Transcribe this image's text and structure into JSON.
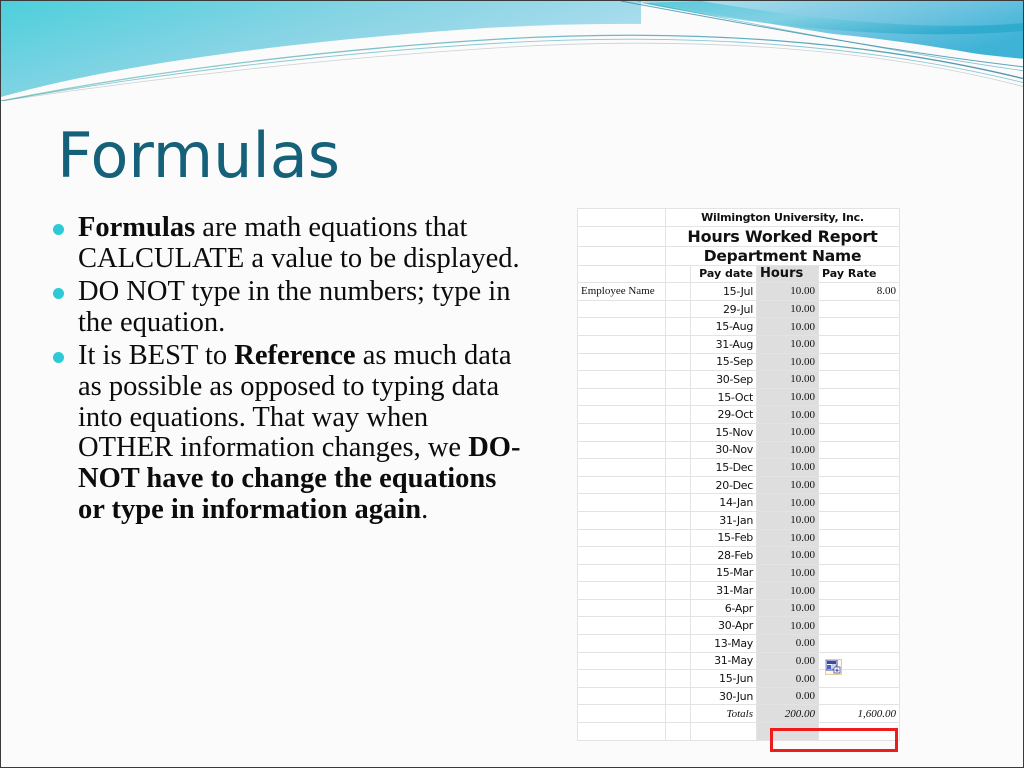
{
  "slide": {
    "title": "Formulas",
    "title_color": "#16617a",
    "bullet_color": "#2ec9d4",
    "bullets": [
      {
        "id": "bullet-formulas-definition",
        "runs": [
          {
            "text": "Formulas",
            "bold": true
          },
          {
            "text": " are math equations that CALCULATE a value to be displayed.",
            "bold": false
          }
        ]
      },
      {
        "id": "bullet-do-not-type-numbers",
        "runs": [
          {
            "text": "DO NOT type in the numbers; type in the equation.",
            "bold": false
          }
        ]
      },
      {
        "id": "bullet-best-to-reference",
        "runs": [
          {
            "text": "It is BEST to ",
            "bold": false
          },
          {
            "text": "Reference",
            "bold": true
          },
          {
            "text": " as much data as possible as opposed to typing data into equations. That way when OTHER information changes, we ",
            "bold": false
          },
          {
            "text": "DO-NOT have to change the equations or type in information again",
            "bold": true
          },
          {
            "text": ".",
            "bold": false
          }
        ]
      }
    ]
  },
  "spreadsheet": {
    "report_titles": [
      "Wilmington University, Inc.",
      "Hours Worked Report",
      "Department Name"
    ],
    "column_headers": {
      "pay_date": "Pay date",
      "hours": "Hours",
      "pay_rate": "Pay Rate"
    },
    "employee_label": "Employee Name",
    "rows": [
      {
        "pay_date": "15-Jul",
        "hours": "10.00",
        "pay_rate": "8.00"
      },
      {
        "pay_date": "29-Jul",
        "hours": "10.00",
        "pay_rate": ""
      },
      {
        "pay_date": "15-Aug",
        "hours": "10.00",
        "pay_rate": ""
      },
      {
        "pay_date": "31-Aug",
        "hours": "10.00",
        "pay_rate": ""
      },
      {
        "pay_date": "15-Sep",
        "hours": "10.00",
        "pay_rate": ""
      },
      {
        "pay_date": "30-Sep",
        "hours": "10.00",
        "pay_rate": ""
      },
      {
        "pay_date": "15-Oct",
        "hours": "10.00",
        "pay_rate": ""
      },
      {
        "pay_date": "29-Oct",
        "hours": "10.00",
        "pay_rate": ""
      },
      {
        "pay_date": "15-Nov",
        "hours": "10.00",
        "pay_rate": ""
      },
      {
        "pay_date": "30-Nov",
        "hours": "10.00",
        "pay_rate": ""
      },
      {
        "pay_date": "15-Dec",
        "hours": "10.00",
        "pay_rate": ""
      },
      {
        "pay_date": "20-Dec",
        "hours": "10.00",
        "pay_rate": ""
      },
      {
        "pay_date": "14-Jan",
        "hours": "10.00",
        "pay_rate": ""
      },
      {
        "pay_date": "31-Jan",
        "hours": "10.00",
        "pay_rate": ""
      },
      {
        "pay_date": "15-Feb",
        "hours": "10.00",
        "pay_rate": ""
      },
      {
        "pay_date": "28-Feb",
        "hours": "10.00",
        "pay_rate": ""
      },
      {
        "pay_date": "15-Mar",
        "hours": "10.00",
        "pay_rate": ""
      },
      {
        "pay_date": "31-Mar",
        "hours": "10.00",
        "pay_rate": ""
      },
      {
        "pay_date": "6-Apr",
        "hours": "10.00",
        "pay_rate": ""
      },
      {
        "pay_date": "30-Apr",
        "hours": "10.00",
        "pay_rate": ""
      },
      {
        "pay_date": "13-May",
        "hours": "0.00",
        "pay_rate": ""
      },
      {
        "pay_date": "31-May",
        "hours": "0.00",
        "pay_rate": ""
      },
      {
        "pay_date": "15-Jun",
        "hours": "0.00",
        "pay_rate": ""
      },
      {
        "pay_date": "30-Jun",
        "hours": "0.00",
        "pay_rate": ""
      }
    ],
    "totals": {
      "label": "Totals",
      "hours": "200.00",
      "pay_rate": "1,600.00"
    },
    "highlight_color": "#ee1c1c",
    "hours_column_fill": "#dedede",
    "smart_tag_icon": "paste-options-icon"
  }
}
